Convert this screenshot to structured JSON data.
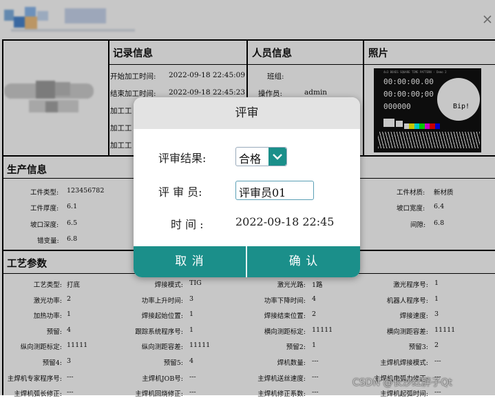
{
  "window": {
    "close_label": "×"
  },
  "record": {
    "header": "记录信息",
    "start_label": "开始加工时间:",
    "start_value": "2022-09-18 22:45:09",
    "end_label": "结束加工时间:",
    "end_value": "2022-09-18 22:45:23",
    "row3": "加工工",
    "row4": "加工工",
    "row5": "加工工"
  },
  "person": {
    "header": "人员信息",
    "team_label": "班组:",
    "operator_label": "操作员:",
    "operator_value": "admin"
  },
  "photo": {
    "header": "照片",
    "line0": "4x3 BOXES SQUARE TIME PATTERN - Demo 2",
    "line1": "00:00:00.00",
    "line2": "00:00:00;00",
    "line3": "000000",
    "bip": "Bip!",
    "colors": [
      "#ffffff",
      "#ffff00",
      "#00ffff",
      "#00ff00",
      "#ff00ff",
      "#ff0000",
      "#0000ff"
    ]
  },
  "production": {
    "header": "生产信息",
    "items": [
      {
        "label": "工件类型:",
        "value": "123456782"
      },
      {
        "label": "工件厚度:",
        "value": "6.1"
      },
      {
        "label": "坡口深度:",
        "value": "6.5"
      },
      {
        "label": "错变量:",
        "value": "6.8"
      },
      {
        "label": "工件材质:",
        "value": "新材质"
      },
      {
        "label": "坡口宽度:",
        "value": "6.4"
      },
      {
        "label": "间隙:",
        "value": "6.8"
      }
    ]
  },
  "process": {
    "header": "工艺参数",
    "rows": [
      [
        [
          "工艺类型:",
          "打底"
        ],
        [
          "焊接模式:",
          "TIG"
        ],
        [
          "激光光路:",
          "1路"
        ],
        [
          "激光程序号:",
          "1"
        ]
      ],
      [
        [
          "激光功率:",
          "2"
        ],
        [
          "功率上升时间:",
          "3"
        ],
        [
          "功率下降时间:",
          "4"
        ],
        [
          "机器人程序号:",
          "1"
        ]
      ],
      [
        [
          "加热功率:",
          "1"
        ],
        [
          "焊接起始位置:",
          "1"
        ],
        [
          "焊接结束位置:",
          "2"
        ],
        [
          "焊接速度:",
          "3"
        ]
      ],
      [
        [
          "预留:",
          "4"
        ],
        [
          "跟踪系统程序号:",
          "1"
        ],
        [
          "横向测距标定:",
          "11111"
        ],
        [
          "横向测距容差:",
          "11111"
        ]
      ],
      [
        [
          "纵向测距标定:",
          "11111"
        ],
        [
          "纵向测距容差:",
          "11111"
        ],
        [
          "预留2:",
          "1"
        ],
        [
          "预留3:",
          "2"
        ]
      ],
      [
        [
          "预留4:",
          "3"
        ],
        [
          "预留5:",
          "4"
        ],
        [
          "焊机数量:",
          "---"
        ],
        [
          "主焊机焊接模式:",
          "---"
        ]
      ],
      [
        [
          "主焊机专家程序号:",
          "---"
        ],
        [
          "主焊机JOB号:",
          "---"
        ],
        [
          "主焊机送丝速度:",
          "---"
        ],
        [
          "主焊机电弧力修正:",
          "---"
        ]
      ],
      [
        [
          "主焊机弧长修正:",
          "---"
        ],
        [
          "主焊机回烧修正:",
          "---"
        ],
        [
          "主焊机修正系数:",
          "---"
        ],
        [
          "主焊机起弧时间:",
          "---"
        ]
      ]
    ]
  },
  "dialog": {
    "title": "评审",
    "result_label": "评审结果:",
    "result_value": "合格",
    "reviewer_label": "评 审 员:",
    "reviewer_value": "评审员01",
    "time_label": "时  间 :",
    "time_value": "2022-09-18  22:45",
    "cancel_label": "取    消",
    "confirm_label": "确    认"
  },
  "watermark": "CSDN @长沙红胖子Qt"
}
